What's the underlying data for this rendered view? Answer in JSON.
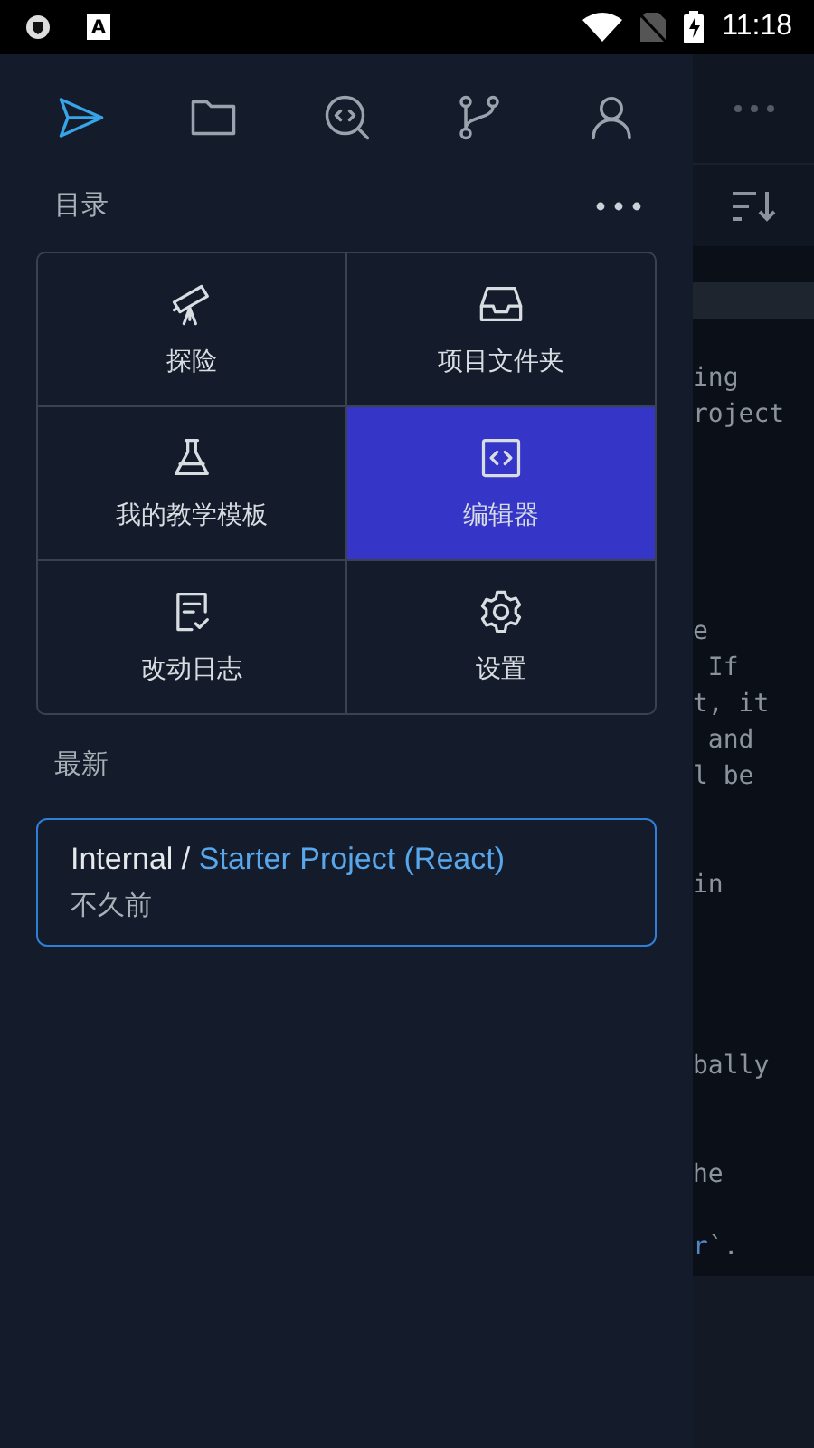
{
  "status_bar": {
    "notification_letter": "A",
    "time": "11:18"
  },
  "drawer": {
    "tabs": [
      {
        "kind": "send",
        "selected": true
      },
      {
        "kind": "folder",
        "selected": false
      },
      {
        "kind": "code-search",
        "selected": false
      },
      {
        "kind": "branch",
        "selected": false
      },
      {
        "kind": "user",
        "selected": false
      }
    ],
    "section_title": "目录",
    "menu": [
      {
        "kind": "telescope",
        "label": "探险",
        "selected": false
      },
      {
        "kind": "inbox",
        "label": "项目文件夹",
        "selected": false
      },
      {
        "kind": "flask",
        "label": "我的教学模板",
        "selected": false
      },
      {
        "kind": "code",
        "label": "编辑器",
        "selected": true
      },
      {
        "kind": "changelog",
        "label": "改动日志",
        "selected": false
      },
      {
        "kind": "gear",
        "label": "设置",
        "selected": false
      }
    ],
    "recent_title": "最新",
    "recent": [
      {
        "owner": "Internal /",
        "project": "Starter Project (React)",
        "time": "不久前"
      }
    ]
  },
  "editor": {
    "code_blocks": [
      [
        [
          {
            "text": "ing",
            "kind": "plain"
          }
        ],
        [
          {
            "text": "roject",
            "kind": "plain"
          }
        ]
      ],
      [
        [
          {
            "text": "e",
            "kind": "plain"
          }
        ],
        [
          {
            "text": " If",
            "kind": "plain"
          }
        ],
        [
          {
            "text": "t, it",
            "kind": "plain"
          }
        ],
        [
          {
            "text": " and",
            "kind": "plain"
          }
        ],
        [
          {
            "text": "l be",
            "kind": "plain"
          }
        ]
      ],
      [
        [
          {
            "text": "in",
            "kind": "plain"
          }
        ]
      ],
      [
        [
          {
            "text": "bally",
            "kind": "plain"
          }
        ]
      ],
      [
        [
          {
            "text": "he",
            "kind": "plain"
          }
        ]
      ],
      [
        [
          {
            "text": "r",
            "kind": "keyword"
          },
          {
            "text": "`.",
            "kind": "plain"
          }
        ]
      ]
    ]
  }
}
